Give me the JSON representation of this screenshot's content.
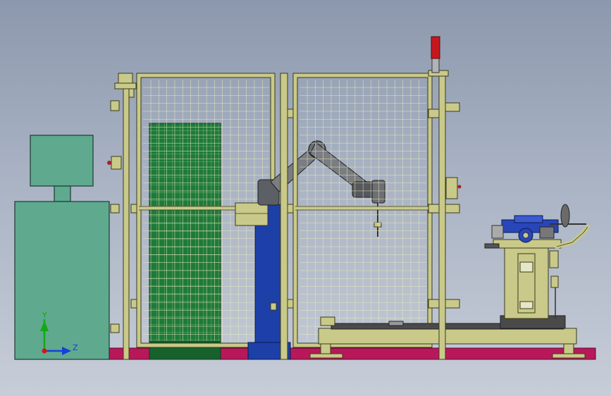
{
  "triad": {
    "y_label": "Y",
    "z_label": "Z"
  },
  "colors": {
    "background_top": "#8c98ad",
    "background_bottom": "#c7cdd8",
    "floor": "#b8185a",
    "cabinet": "#5fa98f",
    "frame": "#c9c98a",
    "mesh": "#e4e4b0",
    "green_panel": "#1f7a3a",
    "robot_base": "#1d3fa8",
    "robot_arm": "#6c6f74",
    "beacon_red": "#c41820",
    "motor_blue": "#2846b8",
    "triad_y": "#14a814",
    "triad_z": "#1640d8",
    "triad_x": "#d81414"
  }
}
